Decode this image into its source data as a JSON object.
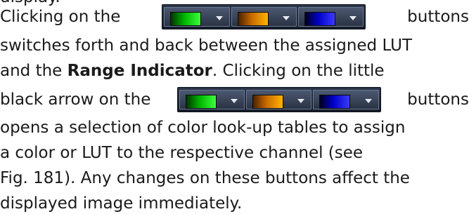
{
  "paragraph": {
    "top_fragment": "display.",
    "l1_before": "Clicking on the",
    "l1_after": "buttons",
    "l2": "switches forth and back between the assigned LUT",
    "l3_before": "and the",
    "l3_bold": "Range Indicator",
    "l3_after": ". Clicking on the little",
    "l4_before": "black arrow on the",
    "l4_after": "buttons",
    "l5": "opens a selection of color look-up tables to assign",
    "l6": "a color or LUT to the respective channel (see",
    "l7": "Fig. 181). Any changes on these buttons affect the",
    "l8": "displayed image immediately."
  },
  "lut_buttons": [
    {
      "channel": "green",
      "color": "#00b400"
    },
    {
      "channel": "orange",
      "color": "#c86a00"
    },
    {
      "channel": "blue",
      "color": "#0000c8"
    }
  ]
}
